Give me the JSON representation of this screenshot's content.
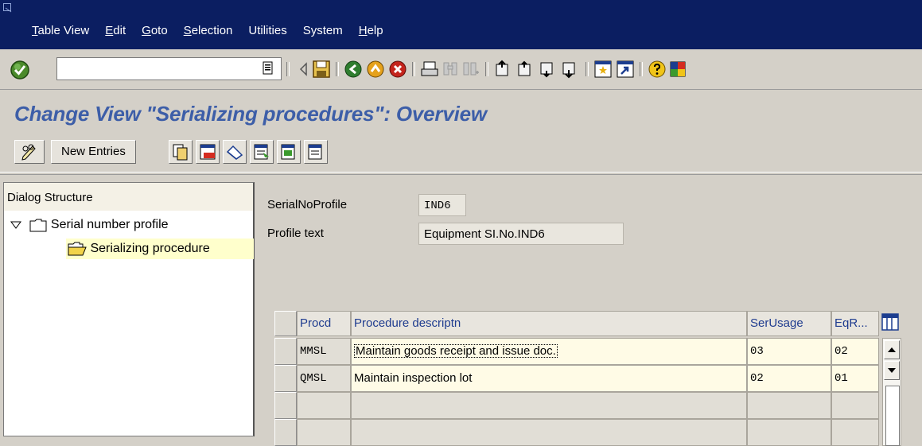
{
  "menu": {
    "items": [
      {
        "mnemonic": "T",
        "rest": "able View"
      },
      {
        "mnemonic": "E",
        "rest": "dit"
      },
      {
        "mnemonic": "G",
        "rest": "oto"
      },
      {
        "mnemonic": "S",
        "rest": "election"
      },
      {
        "mnemonic": "",
        "rest": "Utilities"
      },
      {
        "mnemonic": "",
        "rest": "System"
      },
      {
        "mnemonic": "H",
        "rest": "elp"
      }
    ]
  },
  "command_field": {
    "value": ""
  },
  "page": {
    "title": "Change View \"Serializing procedures\": Overview"
  },
  "app_toolbar": {
    "new_entries_label": "New Entries"
  },
  "dialog_structure": {
    "header": "Dialog Structure",
    "items": [
      {
        "label": "Serial number profile"
      },
      {
        "label": "Serializing procedure"
      }
    ]
  },
  "fields": {
    "serial_no_profile": {
      "label": "SerialNoProfile",
      "value": "IND6"
    },
    "profile_text": {
      "label": "Profile text",
      "value": "Equipment SI.No.IND6"
    }
  },
  "table": {
    "columns": [
      "Procd",
      "Procedure descriptn",
      "SerUsage",
      "EqR..."
    ],
    "rows": [
      {
        "procd": "MMSL",
        "descr": "Maintain goods receipt and issue doc.",
        "serusage": "03",
        "eqr": "02"
      },
      {
        "procd": "QMSL",
        "descr": "Maintain inspection lot",
        "serusage": "02",
        "eqr": "01"
      }
    ]
  },
  "colors": {
    "menubar": "#0b1e61",
    "title": "#3d5ea8",
    "window": "#d4d0c8",
    "selected_tree": "#ffffcc"
  }
}
